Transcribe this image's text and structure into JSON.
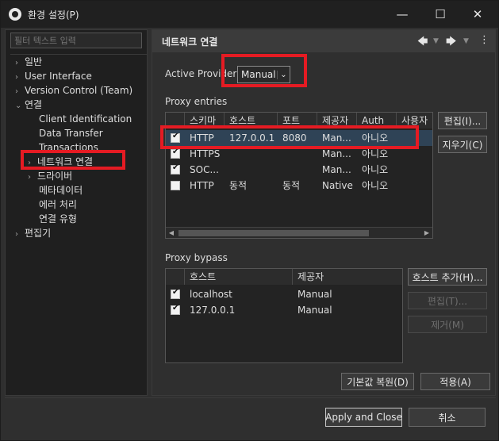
{
  "window": {
    "title": "환경 설정(P)",
    "minimize": "—",
    "maximize": "☐",
    "close": "✕"
  },
  "sidebar": {
    "filter_placeholder": "필터 텍스트 입력",
    "items": [
      {
        "label": "일반",
        "arrow": "›"
      },
      {
        "label": "User Interface",
        "arrow": "›"
      },
      {
        "label": "Version Control (Team)",
        "arrow": "›"
      },
      {
        "label": "연결",
        "arrow": "⌄"
      },
      {
        "label": "Client Identification",
        "arrow": ""
      },
      {
        "label": "Data Transfer",
        "arrow": ""
      },
      {
        "label": "Transactions",
        "arrow": ""
      },
      {
        "label": "네트워크 연결",
        "arrow": "›"
      },
      {
        "label": "드라이버",
        "arrow": "›"
      },
      {
        "label": "메타데이터",
        "arrow": ""
      },
      {
        "label": "에러 처리",
        "arrow": ""
      },
      {
        "label": "연결 유형",
        "arrow": ""
      },
      {
        "label": "편집기",
        "arrow": "›"
      }
    ]
  },
  "page": {
    "title": "네트워크 연결",
    "back_icon": "🡄",
    "forward_icon": "🡆",
    "menu_icon": "⋮",
    "dropdown_icon": "▼",
    "active_provider_label": "Active Provider:",
    "active_provider_value": "Manual",
    "combo_arrow": "⌄",
    "proxy_entries_label": "Proxy entries",
    "proxy_columns": [
      "스키마",
      "호스트",
      "포트",
      "제공자",
      "Auth",
      "사용자"
    ],
    "proxy_rows": [
      {
        "checked": true,
        "scheme": "HTTP",
        "host": "127.0.0.1",
        "port": "8080",
        "provider": "Man...",
        "auth": "아니오",
        "user": ""
      },
      {
        "checked": true,
        "scheme": "HTTPS",
        "host": "",
        "port": "",
        "provider": "Man...",
        "auth": "아니오",
        "user": ""
      },
      {
        "checked": true,
        "scheme": "SOC...",
        "host": "",
        "port": "",
        "provider": "Man...",
        "auth": "아니오",
        "user": ""
      },
      {
        "checked": false,
        "scheme": "HTTP",
        "host": "동적",
        "port": "동적",
        "provider": "Native",
        "auth": "아니오",
        "user": ""
      }
    ],
    "edit_button": "편집(I)...",
    "clear_button": "지우기(C)",
    "scroll_left": "◀",
    "scroll_right": "▶",
    "proxy_bypass_label": "Proxy bypass",
    "bypass_columns": [
      "호스트",
      "제공자"
    ],
    "bypass_rows": [
      {
        "checked": true,
        "host": "localhost",
        "provider": "Manual"
      },
      {
        "checked": true,
        "host": "127.0.0.1",
        "provider": "Manual"
      }
    ],
    "add_host_button": "호스트 추가(H)...",
    "edit_host_button": "편집(T)...",
    "remove_host_button": "제거(M)",
    "restore_defaults_button": "기본값 복원(D)",
    "apply_button": "적용(A)"
  },
  "footer": {
    "apply_close_button": "Apply and Close",
    "cancel_button": "취소"
  },
  "colors": {
    "highlight": "#e51b23",
    "selected_row": "#2f4356"
  }
}
